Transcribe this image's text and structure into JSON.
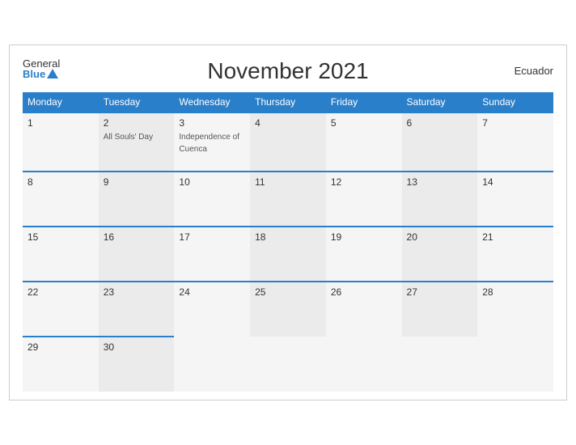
{
  "header": {
    "title": "November 2021",
    "country": "Ecuador",
    "logo_general": "General",
    "logo_blue": "Blue"
  },
  "days_of_week": [
    "Monday",
    "Tuesday",
    "Wednesday",
    "Thursday",
    "Friday",
    "Saturday",
    "Sunday"
  ],
  "weeks": [
    [
      {
        "day": "1",
        "event": ""
      },
      {
        "day": "2",
        "event": "All Souls' Day"
      },
      {
        "day": "3",
        "event": "Independence of Cuenca"
      },
      {
        "day": "4",
        "event": ""
      },
      {
        "day": "5",
        "event": ""
      },
      {
        "day": "6",
        "event": ""
      },
      {
        "day": "7",
        "event": ""
      }
    ],
    [
      {
        "day": "8",
        "event": ""
      },
      {
        "day": "9",
        "event": ""
      },
      {
        "day": "10",
        "event": ""
      },
      {
        "day": "11",
        "event": ""
      },
      {
        "day": "12",
        "event": ""
      },
      {
        "day": "13",
        "event": ""
      },
      {
        "day": "14",
        "event": ""
      }
    ],
    [
      {
        "day": "15",
        "event": ""
      },
      {
        "day": "16",
        "event": ""
      },
      {
        "day": "17",
        "event": ""
      },
      {
        "day": "18",
        "event": ""
      },
      {
        "day": "19",
        "event": ""
      },
      {
        "day": "20",
        "event": ""
      },
      {
        "day": "21",
        "event": ""
      }
    ],
    [
      {
        "day": "22",
        "event": ""
      },
      {
        "day": "23",
        "event": ""
      },
      {
        "day": "24",
        "event": ""
      },
      {
        "day": "25",
        "event": ""
      },
      {
        "day": "26",
        "event": ""
      },
      {
        "day": "27",
        "event": ""
      },
      {
        "day": "28",
        "event": ""
      }
    ],
    [
      {
        "day": "29",
        "event": ""
      },
      {
        "day": "30",
        "event": ""
      },
      {
        "day": "",
        "event": ""
      },
      {
        "day": "",
        "event": ""
      },
      {
        "day": "",
        "event": ""
      },
      {
        "day": "",
        "event": ""
      },
      {
        "day": "",
        "event": ""
      }
    ]
  ]
}
